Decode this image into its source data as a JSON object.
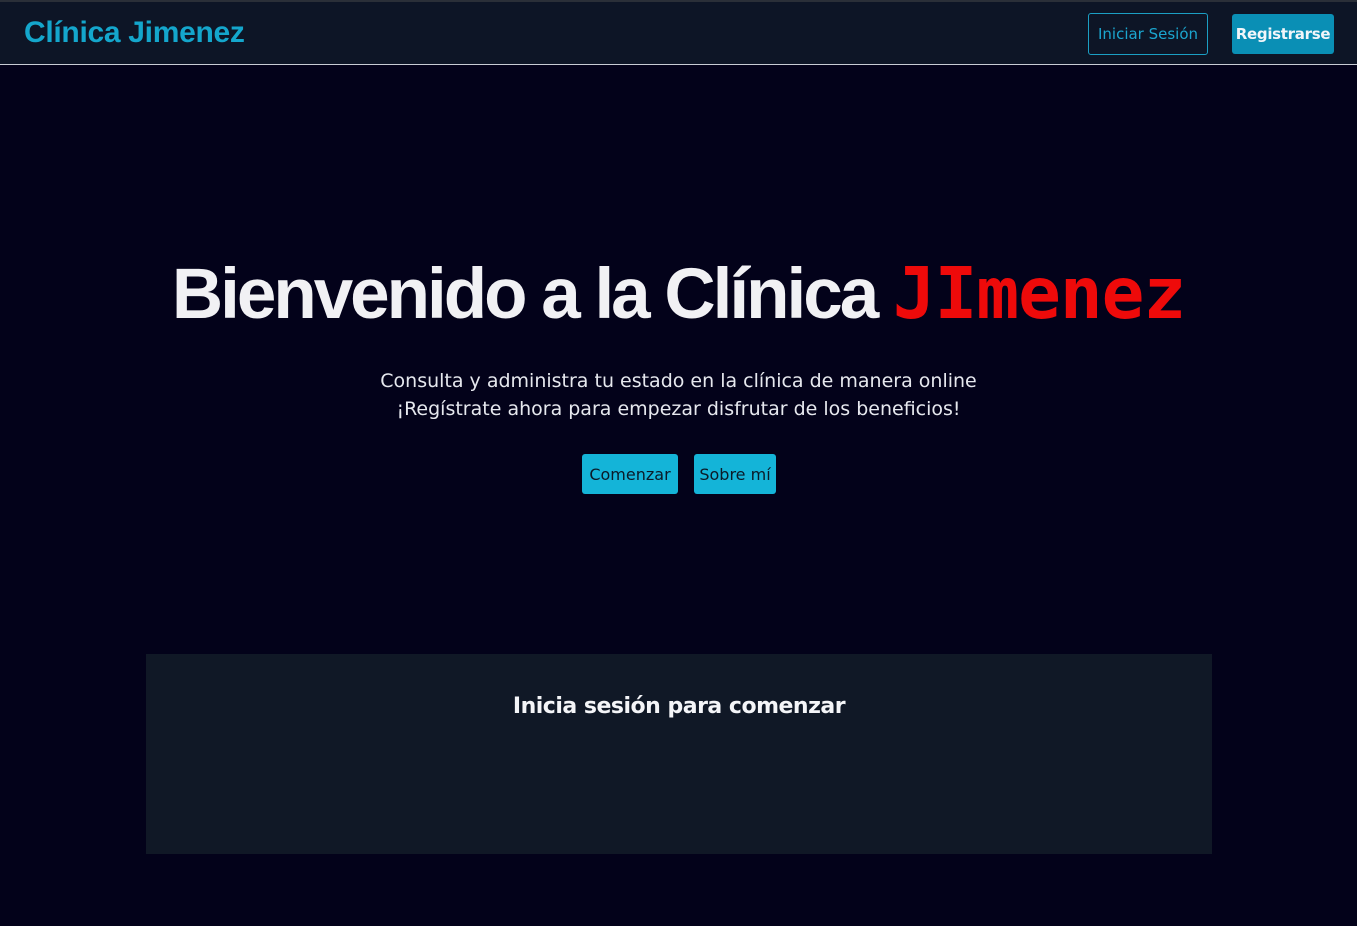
{
  "header": {
    "brand": "Clínica Jimenez",
    "login_label": "Iniciar Sesión",
    "register_label": "Registrarse"
  },
  "hero": {
    "title_main": "Bienvenido a la Clínica ",
    "title_accent": "JImenez",
    "subtitle_line1": "Consulta y administra tu estado en la clínica de manera online",
    "subtitle_line2": "¡Regístrate ahora para empezar disfrutar de los beneficios!",
    "start_label": "Comenzar",
    "about_label": "Sobre mí"
  },
  "panel": {
    "title": "Inicia sesión para comenzar"
  },
  "colors": {
    "background": "#03021a",
    "header_bg": "#0d1526",
    "brand": "#14a6cc",
    "accent_red": "#ee0a0a",
    "button_cyan": "#14b4d8",
    "register_bg": "#0a8fb5",
    "panel_bg": "#101826"
  }
}
